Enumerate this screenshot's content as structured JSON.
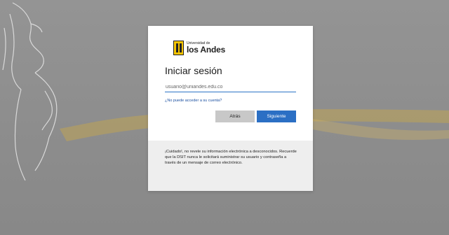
{
  "logo": {
    "line1": "Universidad de",
    "line2": "los Andes"
  },
  "signin": {
    "title": "Iniciar sesión",
    "email_placeholder": "usuario@uniandes.edu.co",
    "help_link": "¿No puede acceder a su cuenta?",
    "back_label": "Atrás",
    "next_label": "Siguiente"
  },
  "notice": {
    "text": "¡Cuidado!, no revele su información electrónica a desconocidos. Recuerde que la DSIT nunca le solicitará suministrar su usuario y contraseña a través de un mensaje de correo electrónico."
  },
  "colors": {
    "accent": "#2b6fc4",
    "logo_yellow": "#f5c400",
    "background": "#8f8f8f"
  }
}
